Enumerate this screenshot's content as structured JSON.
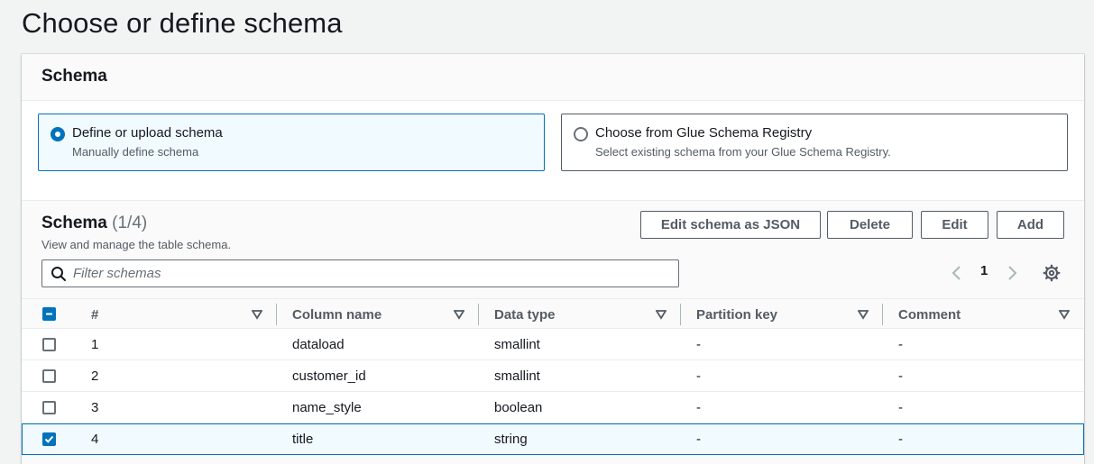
{
  "page": {
    "title": "Choose or define schema"
  },
  "schema_panel": {
    "header": "Schema",
    "options": [
      {
        "title": "Define or upload schema",
        "description": "Manually define schema",
        "selected": true
      },
      {
        "title": "Choose from Glue Schema Registry",
        "description": "Select existing schema from your Glue Schema Registry.",
        "selected": false
      }
    ]
  },
  "table": {
    "title": "Schema",
    "count": "(1/4)",
    "description": "View and manage the table schema.",
    "buttons": {
      "edit_json": "Edit schema as JSON",
      "delete": "Delete",
      "edit": "Edit",
      "add": "Add"
    },
    "filter_placeholder": "Filter schemas",
    "pagination": {
      "current_page": "1"
    },
    "columns": [
      "#",
      "Column name",
      "Data type",
      "Partition key",
      "Comment"
    ],
    "rows": [
      {
        "num": "1",
        "column_name": "dataload",
        "data_type": "smallint",
        "partition_key": "-",
        "comment": "-",
        "checked": false
      },
      {
        "num": "2",
        "column_name": "customer_id",
        "data_type": "smallint",
        "partition_key": "-",
        "comment": "-",
        "checked": false
      },
      {
        "num": "3",
        "column_name": "name_style",
        "data_type": "boolean",
        "partition_key": "-",
        "comment": "-",
        "checked": false
      },
      {
        "num": "4",
        "column_name": "title",
        "data_type": "string",
        "partition_key": "-",
        "comment": "-",
        "checked": true
      }
    ]
  },
  "icons": {
    "search": "search-icon",
    "settings": "gear-icon",
    "prev": "chevron-left-icon",
    "next": "chevron-right-icon",
    "sort": "caret-down-icon"
  },
  "colors": {
    "accent": "#0073bb",
    "selected_bg": "#f1faff",
    "text": "#16191f",
    "muted": "#545b64"
  }
}
